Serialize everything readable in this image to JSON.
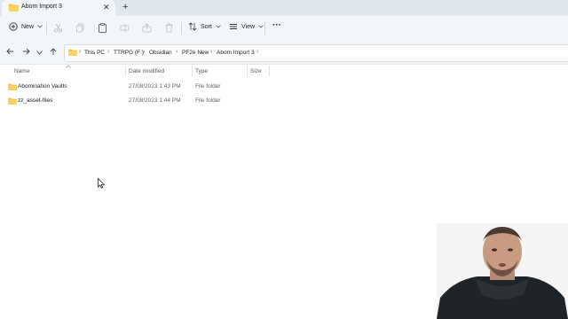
{
  "tab": {
    "title": "Abom Import 3",
    "close": "✕",
    "new_tab": "+"
  },
  "toolbar": {
    "new_label": "New",
    "sort_label": "Sort",
    "view_label": "View",
    "more_label": "···"
  },
  "breadcrumb": [
    "This PC",
    "TTRPG (F:)",
    "Obsidian",
    "PF2e New",
    "Abom Import 3"
  ],
  "columns": {
    "name": "Name",
    "date": "Date modified",
    "type": "Type",
    "size": "Size"
  },
  "rows": [
    {
      "name": "Abomination Vaults",
      "date": "27/08/2023 1:43 PM",
      "type": "File folder",
      "size": ""
    },
    {
      "name": "zz_asset-files",
      "date": "27/08/2023 1:44 PM",
      "type": "File folder",
      "size": ""
    }
  ],
  "colors": {
    "folder": "#f2c744",
    "folder_dark": "#d9a520",
    "titlebar": "#dfe8ef",
    "toolbar": "#f3f6f9"
  }
}
